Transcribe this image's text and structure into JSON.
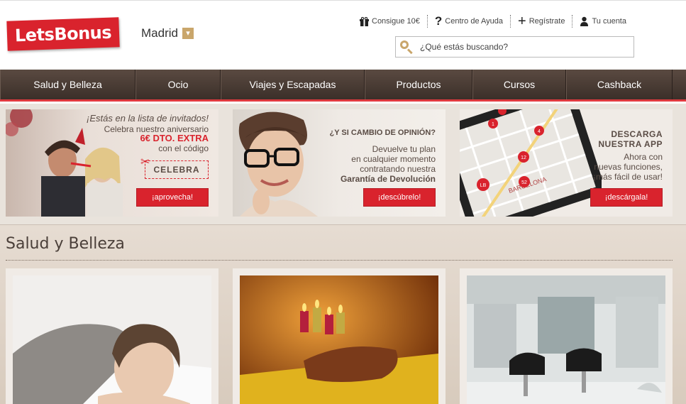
{
  "header": {
    "logo_text": "LetsBonus",
    "city": "Madrid",
    "links": [
      {
        "label": "Consigue 10€",
        "icon": "gift-icon"
      },
      {
        "label": "Centro de Ayuda",
        "icon": "question-icon"
      },
      {
        "label": "Regístrate",
        "icon": "plus-icon"
      },
      {
        "label": "Tu cuenta",
        "icon": "user-icon"
      }
    ],
    "search_placeholder": "¿Qué estás buscando?"
  },
  "nav": {
    "items": [
      "Salud y Belleza",
      "Ocio",
      "Viajes y Escapadas",
      "Productos",
      "Cursos",
      "Cashback"
    ]
  },
  "banners": [
    {
      "line1": "¡Estás en la lista de invitados!",
      "line2": "Celebra nuestro aniversario",
      "line3": "6€ DTO. EXTRA",
      "line4": "con el código",
      "code": "CELEBRA",
      "button": "¡aprovecha!"
    },
    {
      "line1": "¿Y SI CAMBIO DE OPINIÓN?",
      "line2": "Devuelve tu plan",
      "line3": "en cualquier momento",
      "line4": "contratando nuestra",
      "line5": "Garantía de Devolución",
      "button": "¡descúbrelo!"
    },
    {
      "line1": "DESCARGA",
      "line2": "NUESTRA APP",
      "line3": "Ahora con",
      "line4": "nuevas funciones,",
      "line5": "¡más fácil de usar!",
      "map_label": "BARCELONA",
      "pin_labels": [
        "1",
        "4",
        "12",
        "52",
        "LB"
      ],
      "button": "¡descárgala!"
    }
  ],
  "section": {
    "title": "Salud y Belleza"
  },
  "colors": {
    "brand_red": "#d9232d",
    "nav_brown": "#4a3c35",
    "gold": "#c9a66b"
  }
}
